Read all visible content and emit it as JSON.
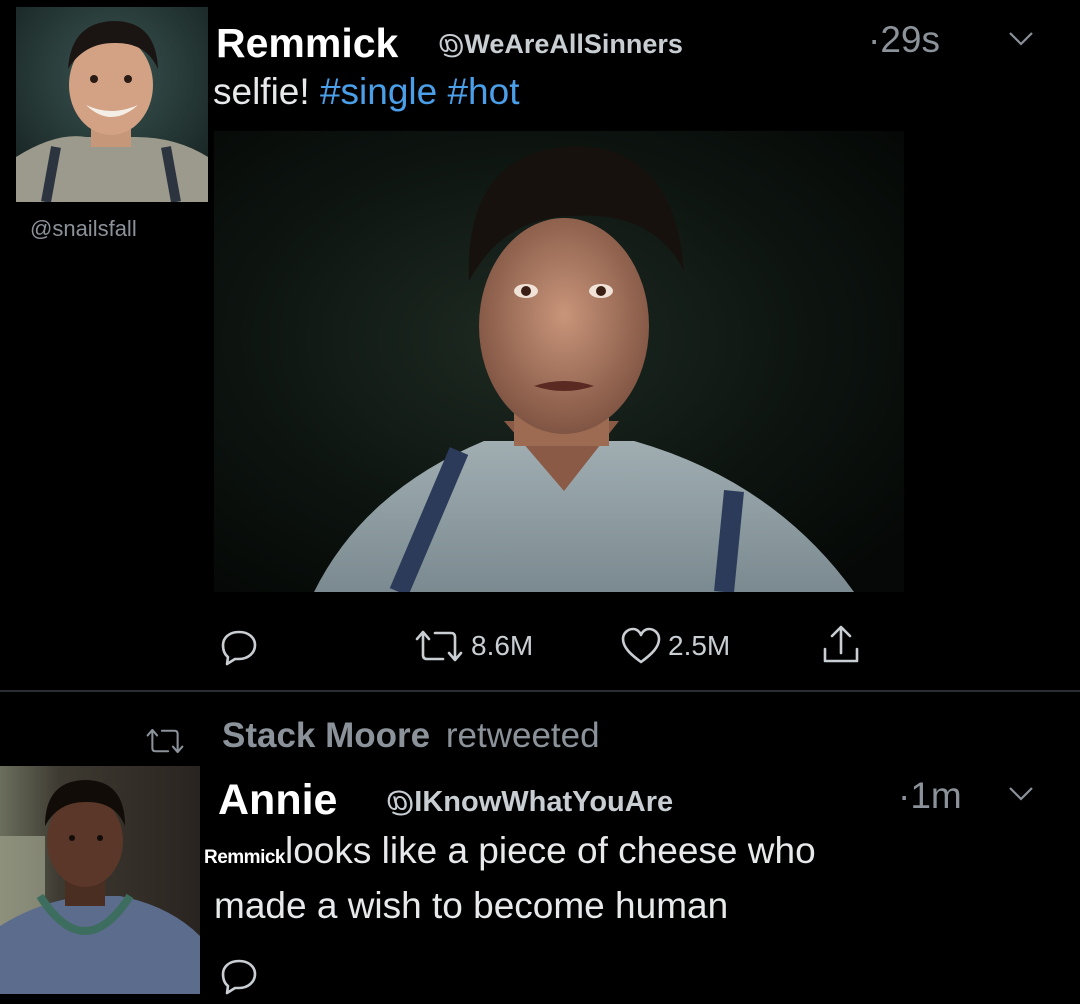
{
  "tweet": {
    "name": "Remmick",
    "handle": "WeAreAllSinners",
    "time": "29s",
    "text_plain": "selfie!",
    "hashtags": [
      "#single",
      "#hot"
    ],
    "actions": {
      "retweets": "8.6M",
      "likes": "2.5M"
    }
  },
  "watermark": "@snailsfall",
  "retweet": {
    "retweeter": "Stack Moore",
    "retweet_word": "retweeted",
    "name": "Annie",
    "handle": "IKnowWhatYouAre",
    "time": "1m",
    "mention_tag": "Remmick",
    "text_line1": "looks like a piece of cheese who",
    "text_line2": "made a wish to become human"
  },
  "colors": {
    "background": "#000000",
    "hashtag": "#4a9fe8",
    "muted": "#8b9299",
    "divider": "#2a2d31"
  },
  "icons": [
    "reply-icon",
    "retweet-icon",
    "like-icon",
    "share-icon",
    "chevron-down-icon"
  ]
}
